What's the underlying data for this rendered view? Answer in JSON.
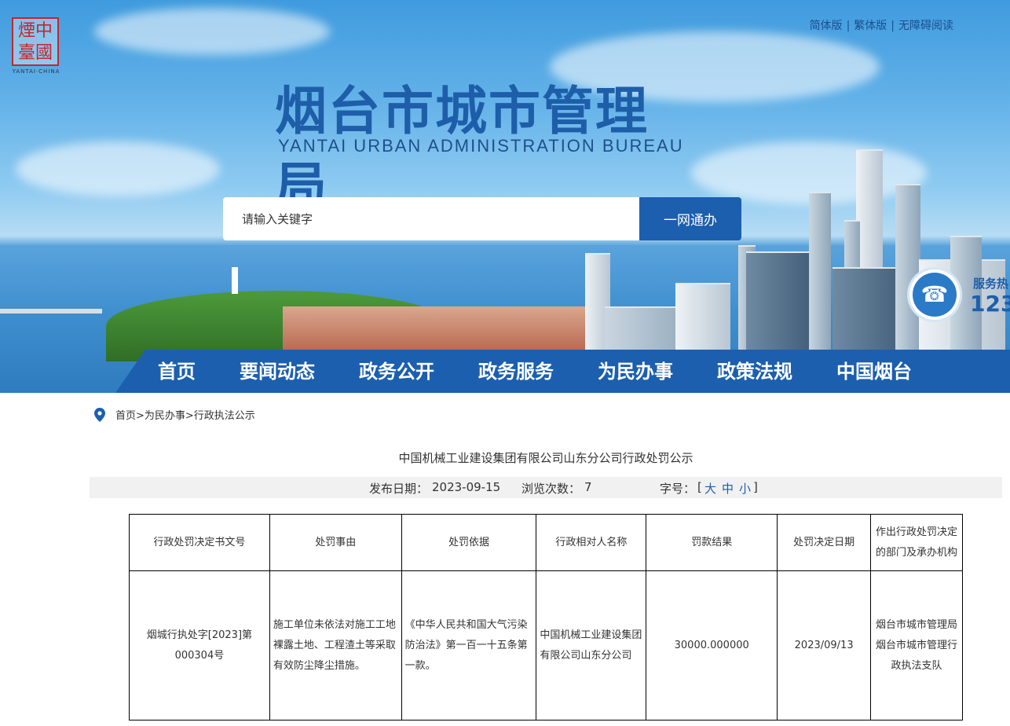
{
  "header": {
    "logo_text": "烟台中國",
    "logo_subtitle": "YANTAI·CHINA",
    "top_links": [
      "简体版",
      "繁体版",
      "无障碍阅读"
    ],
    "site_title": "烟台市城市管理局",
    "site_subtitle": "YANTAI URBAN ADMINISTRATION BUREAU",
    "search": {
      "placeholder": "请输入关键字",
      "button_label": "一网通办"
    },
    "hotline": {
      "label": "服务热",
      "number": "123"
    }
  },
  "nav": {
    "items": [
      "首页",
      "要闻动态",
      "政务公开",
      "政务服务",
      "为民办事",
      "政策法规",
      "中国烟台"
    ]
  },
  "breadcrumb": {
    "text": "首页>为民办事>行政执法公示"
  },
  "article": {
    "title": "中国机械工业建设集团有限公司山东分公司行政处罚公示",
    "publish_label": "发布日期：",
    "publish_date": "2023-09-15",
    "views_label": "浏览次数：",
    "views": "7",
    "font_size_label": "字号：",
    "font_sizes": [
      "大",
      "中",
      "小"
    ]
  },
  "table": {
    "headers": [
      "行政处罚决定书文号",
      "处罚事由",
      "处罚依据",
      "行政相对人名称",
      "罚款结果",
      "处罚决定日期",
      "作出行政处罚决定的部门及承办机构"
    ],
    "rows": [
      [
        "烟城行执处字[2023]第000304号",
        "施工单位未依法对施工工地裸露土地、工程渣土等采取有效防尘降尘措施。",
        "《中华人民共和国大气污染防治法》第一百一十五条第一款。",
        "中国机械工业建设集团有限公司山东分公司",
        "30000.000000",
        "2023/09/13",
        "烟台市城市管理局烟台市城市管理行政执法支队"
      ]
    ]
  }
}
